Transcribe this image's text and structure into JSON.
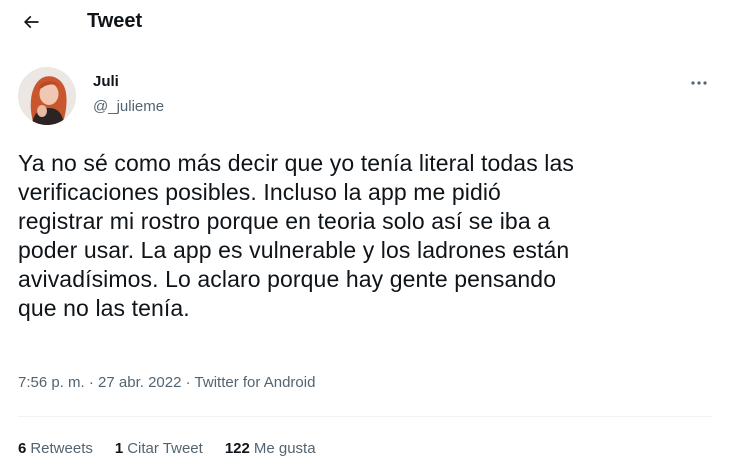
{
  "header": {
    "title": "Tweet",
    "back_icon": "arrow-left-icon"
  },
  "author": {
    "name": "Juli",
    "handle": "@_julieme"
  },
  "more_icon": "more-horizontal-icon",
  "tweet": {
    "text": "Ya no sé como más decir que yo tenía literal todas las\nverificaciones posibles. Incluso la app me pidió\nregistrar mi rostro porque en teoria solo así se iba a\npoder usar. La app es vulnerable y los ladrones están\navivadísimos. Lo aclaro porque hay gente pensando\nque no las tenía."
  },
  "meta": {
    "time": "7:56 p. m.",
    "sep": " · ",
    "date": "27 abr. 2022",
    "source": "Twitter for Android"
  },
  "stats": [
    {
      "count": "6",
      "label": "Retweets"
    },
    {
      "count": "1",
      "label": "Citar Tweet"
    },
    {
      "count": "122",
      "label": "Me gusta"
    }
  ],
  "colors": {
    "text": "#0f1419",
    "secondary": "#536471",
    "divider": "#eff3f4"
  }
}
